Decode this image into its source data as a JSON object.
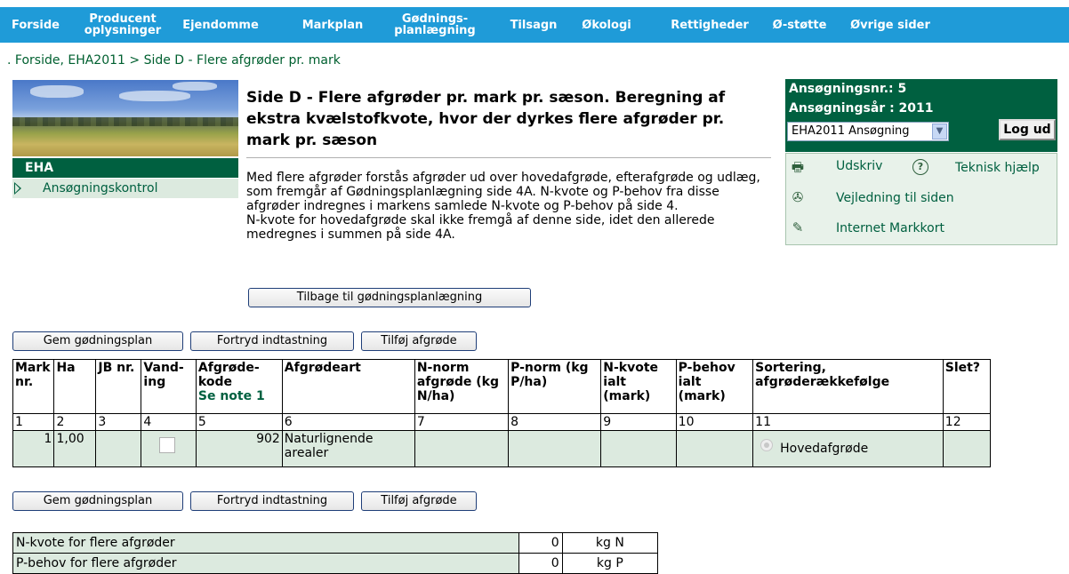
{
  "nav": {
    "items": [
      {
        "label": "Forside"
      },
      {
        "label": "Producent oplysninger"
      },
      {
        "label": "Ejendomme"
      },
      {
        "label": "Markplan"
      },
      {
        "label": "Gødnings- planlægning"
      },
      {
        "label": "Tilsagn"
      },
      {
        "label": "Økologi"
      },
      {
        "label": "Rettigheder"
      },
      {
        "label": "Ø-støtte"
      },
      {
        "label": "Øvrige sider"
      }
    ]
  },
  "breadcrumb": ". Forside, EHA2011 > Side D - Flere afgrøder pr. mark",
  "sidebar": {
    "section_label": "EHA",
    "item_label": "Ansøgningskontrol"
  },
  "title": "Side D - Flere afgrøder pr. mark pr. sæson. Beregning af ekstra kvælstofkvote, hvor der dyrkes flere afgrøder pr. mark pr. sæson",
  "description": {
    "p1": "Med flere afgrøder forstås afgrøder ud over hovedafgrøde, efterafgrøde og udlæg, som fremgår af Gødningsplanlægning side 4A. N-kvote og P-behov fra disse afgrøder indregnes i markens samlede N-kvote og P-behov på side 4.",
    "p2": "N-kvote for hovedafgrøde skal ikke fremgå af denne side, idet den allerede medregnes i summen på side 4A."
  },
  "application": {
    "nr_label": "Ansøgningsnr.: 5",
    "year_label": "Ansøgningsår : 2011",
    "select_value": "EHA2011 Ansøgning",
    "logout": "Log ud"
  },
  "links": {
    "print": "Udskriv",
    "help": "Teknisk hjælp",
    "guide": "Vejledning til siden",
    "map": "Internet Markkort"
  },
  "buttons": {
    "back": "Tilbage til gødningsplanlægning",
    "save": "Gem gødningsplan",
    "undo": "Fortryd indtastning",
    "add": "Tilføj afgrøde"
  },
  "table": {
    "headers": [
      "Mark nr.",
      "Ha",
      "JB nr.",
      "Vand- ing",
      "Afgrøde- kode",
      "Afgrødeart",
      "N-norm afgrøde (kg N/ha)",
      "P-norm (kg P/ha)",
      "N-kvote ialt (mark)",
      "P-behov ialt (mark)",
      "Sortering, afgrøderækkefølge",
      "Slet?"
    ],
    "note_label": "Se note 1",
    "col_numbers": [
      "1",
      "2",
      "3",
      "4",
      "5",
      "6",
      "7",
      "8",
      "9",
      "10",
      "11",
      "12"
    ],
    "row": {
      "mark": "1",
      "ha": "1,00",
      "jb": "",
      "code": "902",
      "crop": "Naturlignende arealer",
      "sort": "Hovedafgrøde"
    }
  },
  "summary": [
    {
      "label": "N-kvote for flere afgrøder",
      "value": "0",
      "unit": "kg N"
    },
    {
      "label": "P-behov for flere afgrøder",
      "value": "0",
      "unit": "kg P"
    }
  ],
  "colors": {
    "nav": "#1F9BD8",
    "dark_green": "#006040",
    "light_green": "#DCEADF"
  }
}
